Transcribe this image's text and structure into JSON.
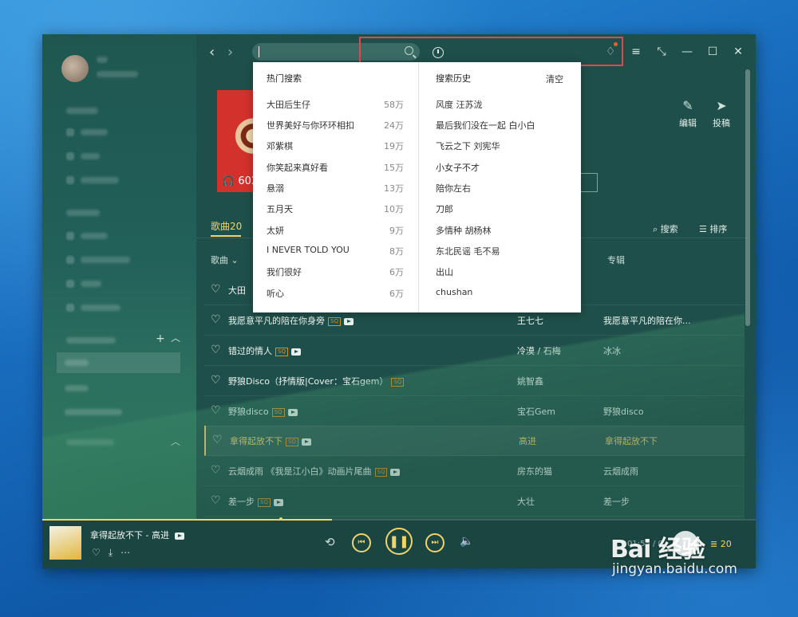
{
  "player_bar": {
    "now_playing": "拿得起放不下 - 高进",
    "time": "01:55 / 0",
    "queue_count": "20"
  },
  "main": {
    "listen_count": "603",
    "edit_label": "编辑",
    "contribute_label": "投稿",
    "tab_label": "歌曲20",
    "search_label": "搜索",
    "sort_label": "排序",
    "col_song": "歌曲",
    "col_album": "专辑",
    "rows": [
      {
        "title": "大田",
        "sq": "",
        "artist": "",
        "album": ""
      },
      {
        "title": "我愿意平凡的陪在你身旁",
        "sq": "SQ",
        "artist": "王七七",
        "album": "我愿意平凡的陪在你..."
      },
      {
        "title": "错过的情人",
        "sq": "SQ",
        "artist": "冷漠 / 石梅",
        "album": "冰冰"
      },
      {
        "title": "野狼Disco（抒情版|Cover：宝石gem）",
        "sq": "SQ",
        "artist": "姚智鑫",
        "album": ""
      },
      {
        "title": "野狼disco",
        "sq": "SQ",
        "artist": "宝石Gem",
        "album": "野狼disco"
      },
      {
        "title": "拿得起放不下",
        "sq": "SQ",
        "artist": "高进",
        "album": "拿得起放不下"
      },
      {
        "title": "云烟成雨 《我是江小白》动画片尾曲",
        "sq": "SQ",
        "artist": "房东的猫",
        "album": "云烟成雨"
      },
      {
        "title": "差一步",
        "sq": "SQ",
        "artist": "大壮",
        "album": "差一步"
      }
    ]
  },
  "dropdown": {
    "hot_title": "热门搜索",
    "history_title": "搜索历史",
    "clear_label": "清空",
    "hot": [
      {
        "name": "大田后生仔",
        "count": "58万"
      },
      {
        "name": "世界美好与你环环相扣",
        "count": "24万"
      },
      {
        "name": "邓紫棋",
        "count": "19万"
      },
      {
        "name": "你笑起来真好看",
        "count": "15万"
      },
      {
        "name": "悬溺",
        "count": "13万"
      },
      {
        "name": "五月天",
        "count": "10万"
      },
      {
        "name": "太妍",
        "count": "9万"
      },
      {
        "name": "I NEVER TOLD YOU",
        "count": "8万"
      },
      {
        "name": "我们很好",
        "count": "6万"
      },
      {
        "name": "听心",
        "count": "6万"
      }
    ],
    "history": [
      "风度 汪苏泷",
      "最后我们没在一起 白小白",
      "飞云之下 刘宪华",
      "小女子不才",
      "陪你左右",
      "刀郎",
      "多情种 胡杨林",
      "东北民谣 毛不易",
      "出山",
      "chushan"
    ]
  },
  "watermark": {
    "logo": "Bai  经验",
    "url": "jingyan.baidu.com"
  },
  "colors": {
    "accent": "#f2d36b",
    "highlight_box": "#e8454a",
    "app_bg": "#1f4f4a"
  }
}
